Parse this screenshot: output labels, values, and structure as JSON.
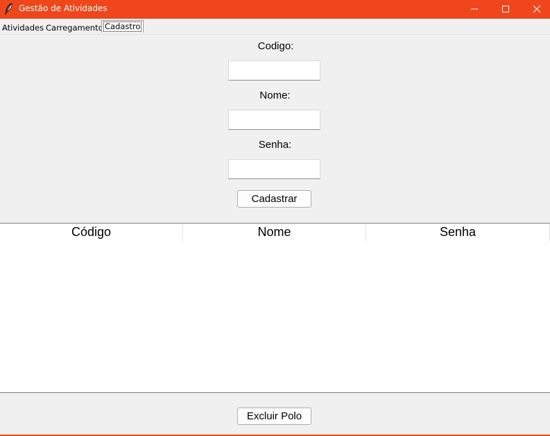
{
  "window": {
    "title": "Gestão de Atividades",
    "accent_color": "#ef461c",
    "icon": "feather-icon",
    "controls": [
      "minimize-icon",
      "maximize-icon",
      "close-icon"
    ]
  },
  "tabs": [
    {
      "label": "Atividades",
      "selected": false
    },
    {
      "label": "Carregamento",
      "selected": false
    },
    {
      "label": "Cadastro",
      "selected": true
    }
  ],
  "form": {
    "code_label": "Codigo:",
    "code_value": "",
    "name_label": "Nome:",
    "name_value": "",
    "password_label": "Senha:",
    "password_value": "",
    "register_button": "Cadastrar"
  },
  "table": {
    "columns": [
      "Código",
      "Nome",
      "Senha"
    ],
    "rows": []
  },
  "bottom": {
    "delete_button": "Excluir Polo"
  }
}
